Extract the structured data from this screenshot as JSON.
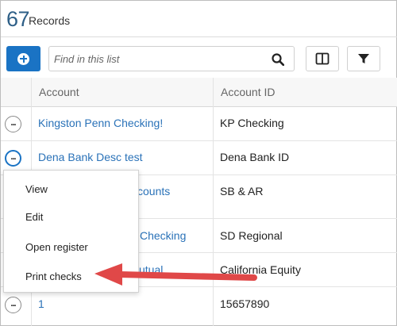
{
  "header": {
    "record_count": "67",
    "record_label": "Records"
  },
  "toolbar": {
    "search_placeholder": "Find in this list"
  },
  "table": {
    "columns": [
      "Account",
      "Account ID"
    ],
    "rows": [
      {
        "account": "Kingston Penn Checking!",
        "account_id": "KP Checking"
      },
      {
        "account": "Dena Bank Desc test",
        "account_id": "Dena Bank ID"
      },
      {
        "account": "counts",
        "account_id": "SB & AR"
      },
      {
        "account": "Checking",
        "account_id": "SD Regional"
      },
      {
        "account": "utual",
        "account_id": "California Equity"
      },
      {
        "account": "1",
        "account_id": "15657890"
      }
    ]
  },
  "context_menu": {
    "items": [
      "View",
      "Edit",
      "Open register",
      "Print checks"
    ]
  },
  "colors": {
    "accent": "#1a73c4",
    "count_text": "#2e5f87",
    "link": "#2a72b8",
    "callout_arrow": "#e04848"
  },
  "icons": {
    "add": "plus-circle-icon",
    "search": "search-icon",
    "columns": "columns-icon",
    "filter": "filter-icon",
    "row_actions": "ellipsis-icon"
  }
}
